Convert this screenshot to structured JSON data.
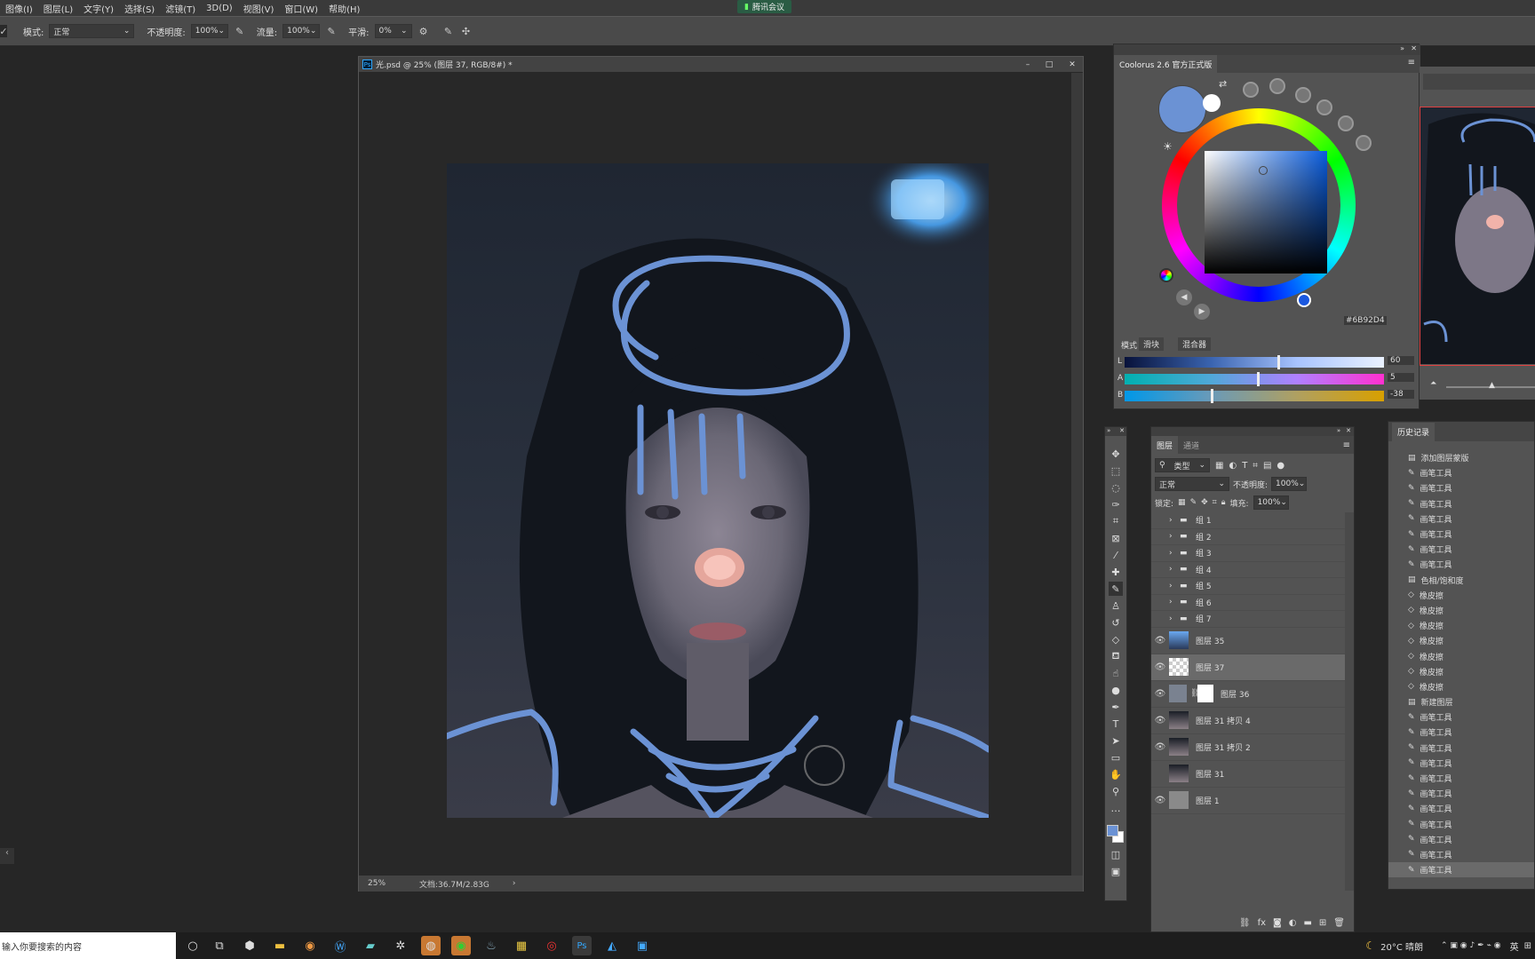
{
  "menubar": {
    "items": [
      "图像(I)",
      "图层(L)",
      "文字(Y)",
      "选择(S)",
      "滤镜(T)",
      "3D(D)",
      "视图(V)",
      "窗口(W)",
      "帮助(H)"
    ],
    "meeting_label": "腾讯会议"
  },
  "options": {
    "mode_label": "模式:",
    "mode_value": "正常",
    "opacity_label": "不透明度:",
    "opacity_value": "100%",
    "flow_label": "流量:",
    "flow_value": "100%",
    "smooth_label": "平滑:",
    "smooth_value": "0%"
  },
  "document": {
    "title": "光.psd @ 25% (图层 37, RGB/8#) *",
    "zoom": "25%",
    "doc_info": "文档:36.7M/2.83G"
  },
  "coolorus": {
    "title": "Coolorus 2.6 官方正式版",
    "hex": "#6B92D4",
    "current_color": "#6B92D4",
    "mode_label": "模式",
    "mode_sliders": "滑块",
    "mode_mixer": "混合器",
    "sliders": [
      {
        "label": "L",
        "value": "60"
      },
      {
        "label": "A",
        "value": "5"
      },
      {
        "label": "B",
        "value": "-38"
      }
    ]
  },
  "layers": {
    "tabs": [
      "图层",
      "通道"
    ],
    "filter_label": "类型",
    "blend_mode": "正常",
    "opacity_label": "不透明度:",
    "opacity_value": "100%",
    "lock_label": "锁定:",
    "fill_label": "填充:",
    "fill_value": "100%",
    "groups": [
      "组 1",
      "组 2",
      "组 3",
      "组 4",
      "组 5",
      "组 6",
      "组 7"
    ],
    "items": [
      {
        "name": "图层 35",
        "visible": true,
        "selected": false
      },
      {
        "name": "图层 37",
        "visible": true,
        "selected": true
      },
      {
        "name": "图层 36",
        "visible": true,
        "selected": false
      },
      {
        "name": "图层 31 拷贝 4",
        "visible": true,
        "selected": false
      },
      {
        "name": "图层 31 拷贝 2",
        "visible": true,
        "selected": false
      },
      {
        "name": "图层 31",
        "visible": false,
        "selected": false
      },
      {
        "name": "图层 1",
        "visible": true,
        "selected": false
      }
    ]
  },
  "history": {
    "tab": "历史记录",
    "items": [
      "添加图层蒙版",
      "画笔工具",
      "画笔工具",
      "画笔工具",
      "画笔工具",
      "画笔工具",
      "画笔工具",
      "画笔工具",
      "色相/饱和度",
      "橡皮擦",
      "橡皮擦",
      "橡皮擦",
      "橡皮擦",
      "橡皮擦",
      "橡皮擦",
      "橡皮擦",
      "新建图层",
      "画笔工具",
      "画笔工具",
      "画笔工具",
      "画笔工具",
      "画笔工具",
      "画笔工具",
      "画笔工具",
      "画笔工具",
      "画笔工具",
      "画笔工具",
      "画笔工具"
    ]
  },
  "taskbar": {
    "search_placeholder": "输入你要搜索的内容",
    "weather": "20°C 晴朗",
    "ime": "英"
  },
  "colors": {
    "accent_blue": "#6B92D4",
    "ps_blue": "#31a8ff",
    "panel_bg": "#535353"
  }
}
